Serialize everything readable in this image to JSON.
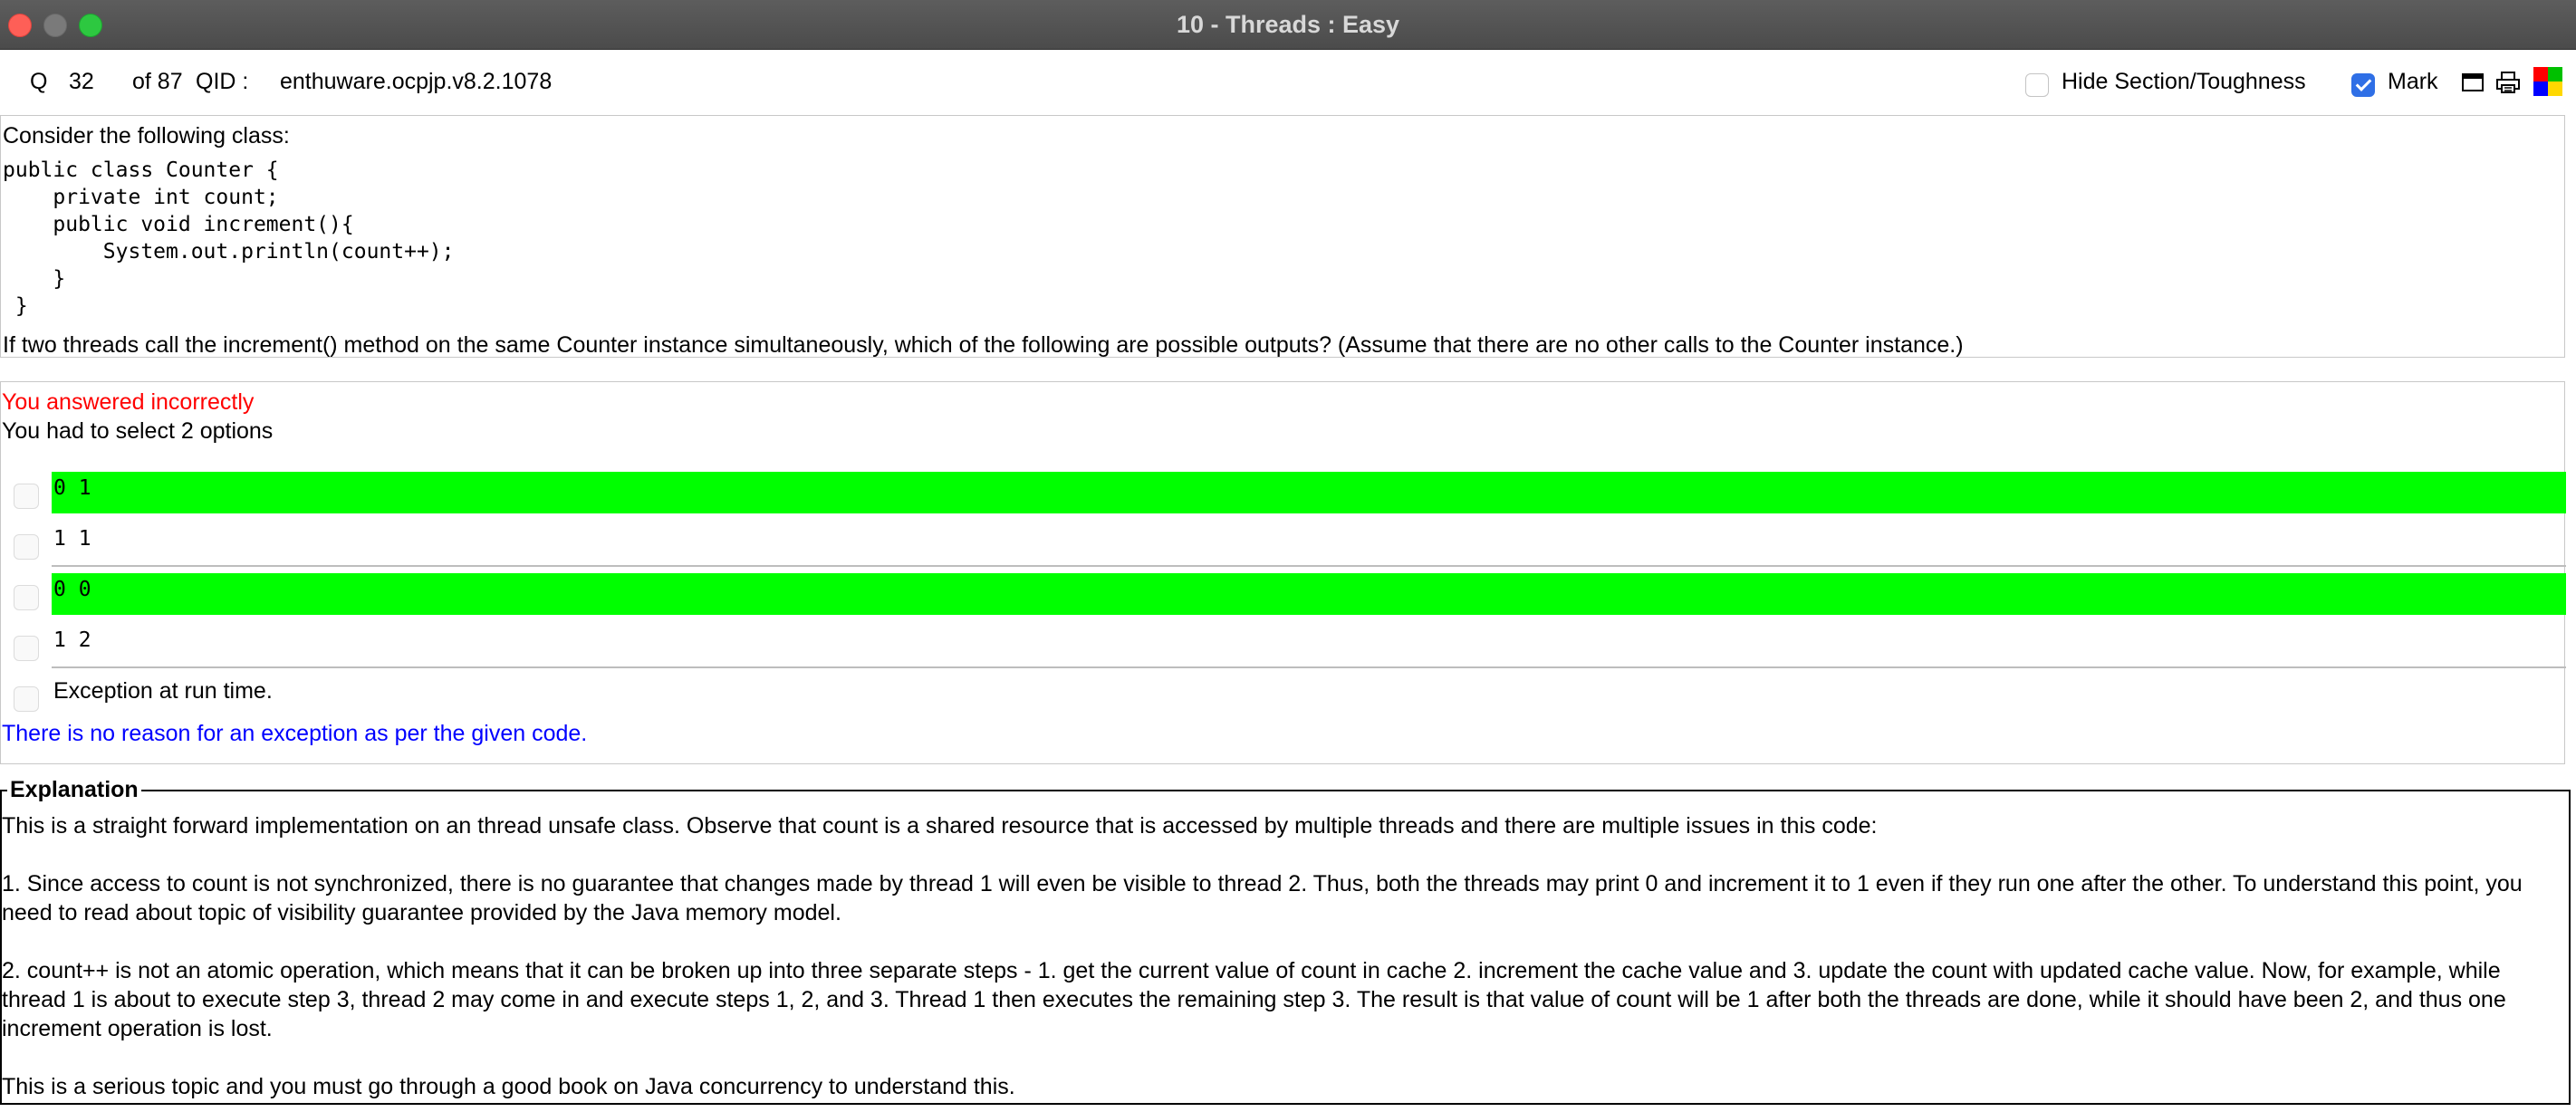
{
  "window": {
    "title": "10 - Threads  : Easy"
  },
  "header": {
    "q_label": "Q",
    "q_number": "32",
    "of_total": "of 87",
    "qid_label": "QID :",
    "qid": "enthuware.ocpjp.v8.2.1078",
    "hide_label": "Hide Section/Toughness",
    "hide_checked": false,
    "mark_label": "Mark",
    "mark_checked": true
  },
  "question": {
    "intro": "Consider the following class:",
    "code": "public class Counter {\n    private int count;\n    public void increment(){\n        System.out.println(count++);\n    }\n }",
    "text": "If two threads call the increment() method on the same Counter instance simultaneously, which of the following are possible outputs? (Assume that there are no other calls to the Counter instance.)"
  },
  "answer": {
    "status": "You answered incorrectly",
    "required": "You had to select 2 options",
    "options": [
      {
        "label": "0 1",
        "correct": true
      },
      {
        "label": "1 1",
        "correct": false
      },
      {
        "label": "0 0",
        "correct": true
      },
      {
        "label": "1 2",
        "correct": false
      },
      {
        "label": "Exception at run time.",
        "correct": false
      }
    ],
    "option_note": "There is no reason for an exception as per the given code."
  },
  "explanation": {
    "legend": "Explanation",
    "body": "This is a straight forward implementation on an thread unsafe class. Observe that count is a shared resource that is accessed by multiple threads and there are multiple issues in this code:\n\n1. Since access to count is not synchronized, there is no guarantee that changes made by thread 1 will even be visible to thread 2. Thus, both the threads may print 0 and increment it to 1 even if they run one after the other. To understand this point, you need to read about topic of visibility guarantee provided by the Java memory model.\n\n2. count++ is not an atomic operation, which means that it can be broken up into three separate steps - 1. get the current value of count in cache 2. increment the cache value and 3. update the count with updated cache value. Now, for example, while thread 1 is about to execute step 3, thread 2 may come in and execute steps 1, 2, and 3. Thread 1 then executes the remaining step 3. The result is that value of count will be 1 after both the threads are done, while it should have been 2, and thus one increment operation is lost.\n\nThis is a serious topic and you must go through a good book on Java concurrency to understand this."
  },
  "colors": {
    "correct_bg": "#00ff00",
    "wrong_text": "#ff0000",
    "note_text": "#0000ff",
    "mark_blue": "#2f6fe6"
  },
  "icons": [
    "close-icon",
    "minimize-icon",
    "zoom-icon",
    "window-icon",
    "print-icon",
    "color-grid-icon"
  ]
}
